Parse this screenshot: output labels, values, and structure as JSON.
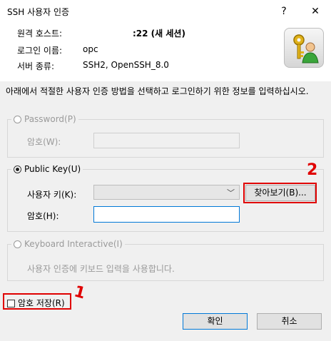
{
  "window": {
    "title": "SSH 사용자 인증",
    "help_glyph": "?",
    "close_glyph": "✕"
  },
  "info": {
    "host_label": "원격 호스트:",
    "host_value": ":22 (새 세션)",
    "login_label": "로그인 이름:",
    "login_value": "opc",
    "server_label": "서버 종류:",
    "server_value": "SSH2, OpenSSH_8.0",
    "icon": "key-user-icon"
  },
  "description": "아래에서 적절한 사용자 인증 방법을 선택하고 로그인하기 위한 정보를 입력하십시오.",
  "password_group": {
    "label": "Password(P)",
    "field_label": "암호(W):",
    "field_value": ""
  },
  "publickey_group": {
    "label": "Public Key(U)",
    "user_key_label": "사용자 키(K):",
    "user_key_value": "",
    "browse_label": "찾아보기(B)...",
    "passphrase_label": "암호(H):",
    "passphrase_value": ""
  },
  "keyboard_group": {
    "label": "Keyboard Interactive(I)",
    "note": "사용자 인증에 키보드 입력을 사용합니다."
  },
  "save_password": {
    "label": "암호 저장(R)",
    "checked": false
  },
  "buttons": {
    "ok": "확인",
    "cancel": "취소"
  },
  "annotations": {
    "mark1": "1",
    "mark2": "2",
    "color": "#e00000"
  }
}
